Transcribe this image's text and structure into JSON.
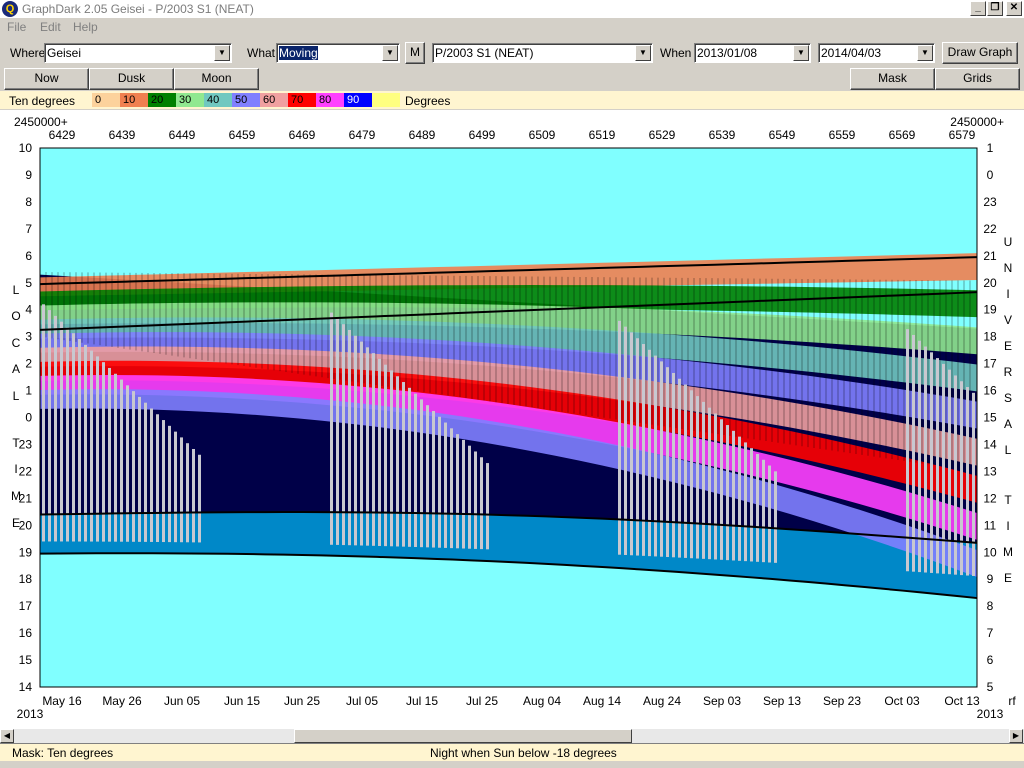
{
  "window": {
    "title": "GraphDark 2.05  Geisei  -  P/2003 S1 (NEAT)"
  },
  "menu": [
    "File",
    "Edit",
    "Help"
  ],
  "toolbar": {
    "where_label": "Where",
    "where_value": "Geisei",
    "what_label": "What",
    "what_value": "Moving",
    "m_button": "M",
    "object_value": "P/2003 S1 (NEAT)",
    "when_label": "When",
    "start_date": "2013/01/08",
    "end_date": "2014/04/03",
    "draw_button": "Draw Graph"
  },
  "buttons": {
    "now": "Now",
    "dusk": "Dusk",
    "moon": "Moon",
    "mask": "Mask",
    "grids": "Grids"
  },
  "legend": {
    "label": "Ten degrees",
    "unit": "Degrees",
    "steps": [
      {
        "t": "0",
        "c": "#fcd29c"
      },
      {
        "t": "10",
        "c": "#f08050"
      },
      {
        "t": "20",
        "c": "#008000"
      },
      {
        "t": "30",
        "c": "#90e890"
      },
      {
        "t": "40",
        "c": "#70c8c0"
      },
      {
        "t": "50",
        "c": "#8080ff"
      },
      {
        "t": "60",
        "c": "#f0a0a0"
      },
      {
        "t": "70",
        "c": "#ff0000"
      },
      {
        "t": "80",
        "c": "#ff40ff"
      },
      {
        "t": "90",
        "c": "#0000ff"
      },
      {
        "t": "",
        "c": "#ffff80"
      }
    ]
  },
  "chart_data": {
    "type": "area",
    "jd_prefix_left": "2450000+",
    "jd_prefix_right": "2450000+",
    "jd_ticks": [
      "6429",
      "6439",
      "6449",
      "6459",
      "6469",
      "6479",
      "6489",
      "6499",
      "6509",
      "6519",
      "6529",
      "6539",
      "6549",
      "6559",
      "6569",
      "6579"
    ],
    "date_ticks": [
      "May 16",
      "May 26",
      "Jun 05",
      "Jun 15",
      "Jun 25",
      "Jul 05",
      "Jul 15",
      "Jul 25",
      "Aug 04",
      "Aug 14",
      "Aug 24",
      "Sep 03",
      "Sep 13",
      "Sep 23",
      "Oct 03",
      "Oct 13"
    ],
    "year_left": "2013",
    "year_right": "2013",
    "left_axis_ticks": [
      "10",
      "9",
      "8",
      "7",
      "6",
      "5",
      "4",
      "3",
      "2",
      "1",
      "0",
      "23",
      "22",
      "21",
      "20",
      "19",
      "18",
      "17",
      "16",
      "15",
      "14"
    ],
    "right_axis_ticks": [
      "1",
      "0",
      "23",
      "22",
      "21",
      "20",
      "19",
      "18",
      "17",
      "16",
      "15",
      "14",
      "13",
      "12",
      "11",
      "10",
      "9",
      "8",
      "7",
      "6",
      "5"
    ],
    "left_axis_title": "LOCAL TIME",
    "right_axis_title_1": "UNIVERSAL",
    "right_axis_title_2": "TIME",
    "right_corner_label": "rf",
    "colors": {
      "day": "#80ffff",
      "night": "#000048",
      "twilight": "#0088c8",
      "moon": "#c8c8d0"
    }
  },
  "status": {
    "mask": "Mask:  Ten degrees",
    "night": "Night when Sun below -18 degrees"
  }
}
